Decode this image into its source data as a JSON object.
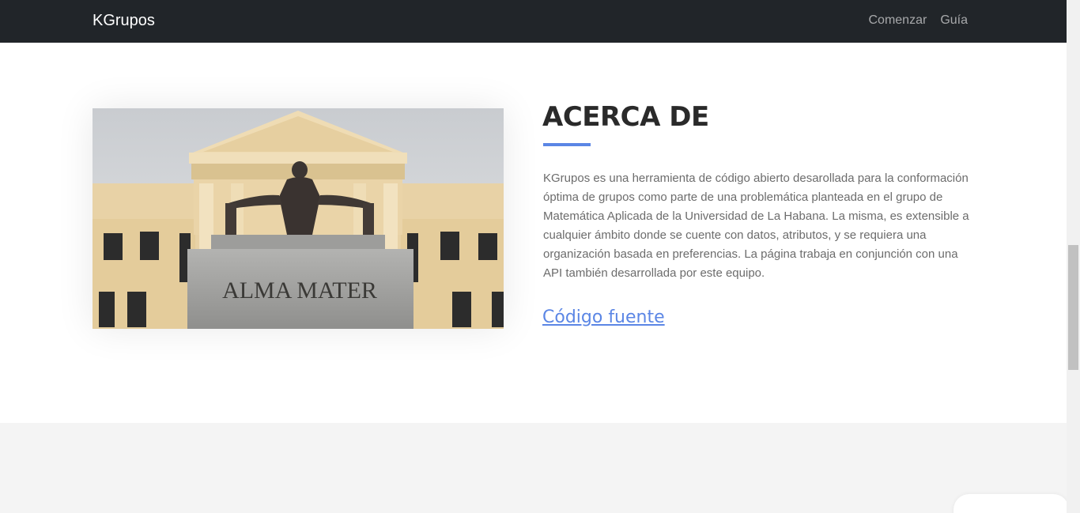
{
  "navbar": {
    "brand": "KGrupos",
    "links": [
      "Comenzar",
      "Guía"
    ]
  },
  "about": {
    "image_text": "ALMA MATER",
    "title": "ACERCA DE",
    "description": "KGrupos es una herramienta de código abierto desarollada para la conformación óptima de grupos como parte de una problemática planteada en el grupo de Matemática Aplicada de la Universidad de La Habana. La misma, es extensible a cualquier ámbito donde se cuente con datos, atributos, y se requiera una organización basada en preferencias. La página trabaja en conjunción con una API también desarrollada por este equipo.",
    "source_link": "Código fuente"
  },
  "colors": {
    "navbar_bg": "#212529",
    "accent": "#5b86e5",
    "lower_section_bg": "#f4f4f4"
  }
}
